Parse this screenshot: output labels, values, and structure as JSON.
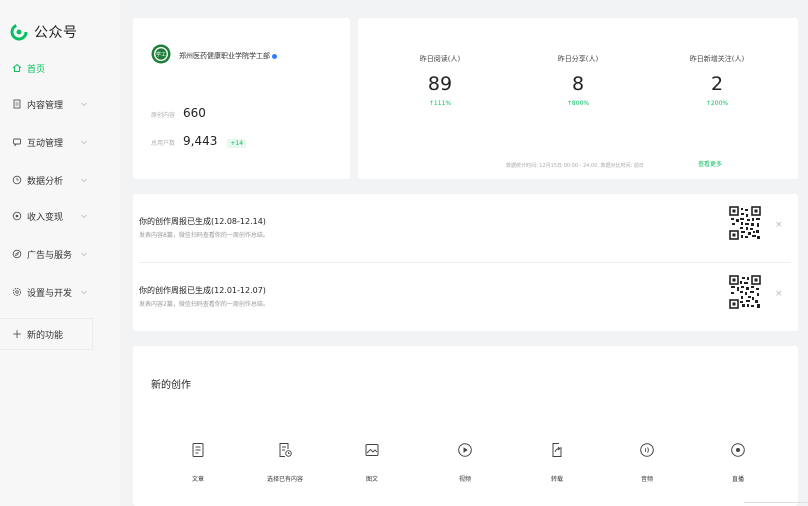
{
  "app": {
    "title": "公众号"
  },
  "sidebar": {
    "items": [
      {
        "label": "首页",
        "icon": "home-icon",
        "active": true
      },
      {
        "label": "内容管理",
        "icon": "document-icon"
      },
      {
        "label": "互动管理",
        "icon": "chat-icon"
      },
      {
        "label": "数据分析",
        "icon": "clock-icon"
      },
      {
        "label": "收入变现",
        "icon": "coin-icon"
      },
      {
        "label": "广告与服务",
        "icon": "compass-icon"
      },
      {
        "label": "设置与开发",
        "icon": "gear-icon"
      }
    ],
    "new_feature": {
      "label": "新的功能",
      "icon": "plus-icon"
    }
  },
  "account": {
    "name": "郑州医药健康职业学院学工部",
    "avatar_text": "学工",
    "content_label": "原创内容",
    "content_count": "660",
    "users_label": "总用户数",
    "users_count": "9,443",
    "users_delta": "+14"
  },
  "stats": {
    "items": [
      {
        "label": "昨日阅读(人)",
        "value": "89",
        "change": "↑111%"
      },
      {
        "label": "昨日分享(人)",
        "value": "8",
        "change": "↑800%"
      },
      {
        "label": "昨日新增关注(人)",
        "value": "2",
        "change": "↑200%"
      }
    ],
    "footnote": "数据统计时间: 12月15日 00:00 - 24:00, 数据对比时间: 前日",
    "view_more": "查看更多"
  },
  "reports": [
    {
      "title": "你的创作周报已生成(12.08-12.14)",
      "subtitle": "发表内容8篇，微信扫码查看你的一周创作总结。",
      "close": "×"
    },
    {
      "title": "你的创作周报已生成(12.01-12.07)",
      "subtitle": "发表内容2篇，微信扫码查看你的一周创作总结。",
      "close": "×"
    }
  ],
  "create": {
    "title": "新的创作",
    "tools": [
      {
        "label": "文章",
        "icon": "article-icon"
      },
      {
        "label": "选择已有内容",
        "icon": "existing-content-icon"
      },
      {
        "label": "图文",
        "icon": "image-text-icon"
      },
      {
        "label": "视频",
        "icon": "video-icon"
      },
      {
        "label": "转载",
        "icon": "repost-icon"
      },
      {
        "label": "音频",
        "icon": "audio-icon"
      },
      {
        "label": "直播",
        "icon": "live-icon"
      }
    ]
  },
  "colors": {
    "accent": "#07c160",
    "verify": "#2b7cff"
  }
}
